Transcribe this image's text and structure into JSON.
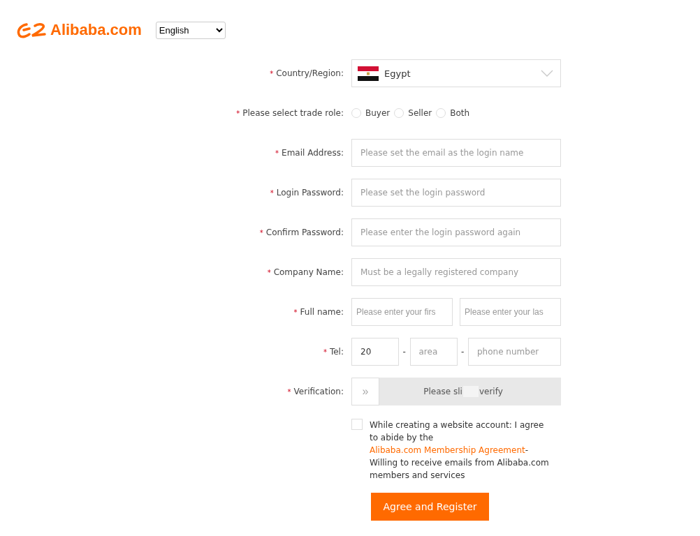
{
  "header": {
    "logo": "Alibaba.com",
    "language": "English"
  },
  "fields": [
    {
      "kind": "country",
      "marker": "*",
      "label": "Country/Region:",
      "value": "Egypt"
    },
    {
      "kind": "role",
      "marker": "*",
      "label": "Please select trade role:",
      "options": [
        {
          "label": "Buyer",
          "selected": false
        },
        {
          "label": "Seller",
          "selected": false
        },
        {
          "label": "Both",
          "selected": false
        }
      ]
    },
    {
      "kind": "text",
      "marker": "*",
      "label": "Email Address:",
      "placeholder": "Please set the email as the login name"
    },
    {
      "kind": "text",
      "marker": "*",
      "label": "Login Password:",
      "placeholder": "Please set the login password"
    },
    {
      "kind": "text",
      "marker": "*",
      "label": "Confirm Password:",
      "placeholder": "Please enter the login password again"
    },
    {
      "kind": "text",
      "marker": "*",
      "label": "Company Name:",
      "placeholder": "Must be a legally registered company"
    },
    {
      "kind": "pair",
      "marker": "*",
      "label": "Full name:",
      "placeholders": [
        "Please enter your firs",
        "Please enter your las"
      ]
    },
    {
      "kind": "tel",
      "marker": "*",
      "label": "Tel:",
      "parts": [
        {
          "kind": "input",
          "value": "20"
        },
        {
          "kind": "sep",
          "text": "-"
        },
        {
          "kind": "input",
          "placeholder": "area"
        },
        {
          "kind": "sep",
          "text": "-"
        },
        {
          "kind": "input",
          "placeholder": "phone number"
        }
      ]
    },
    {
      "kind": "slider",
      "marker": "*",
      "label": "Verification:",
      "handle": "»",
      "texts": [
        "Please sli",
        "verify"
      ]
    }
  ],
  "agreement": {
    "checked": false,
    "before": "While creating a website account: I agree to abide by the",
    "link": "Alibaba.com Membership Agreement",
    "after": "- Willing to receive emails from Alibaba.com members and services"
  },
  "submit": "Agree and Register"
}
